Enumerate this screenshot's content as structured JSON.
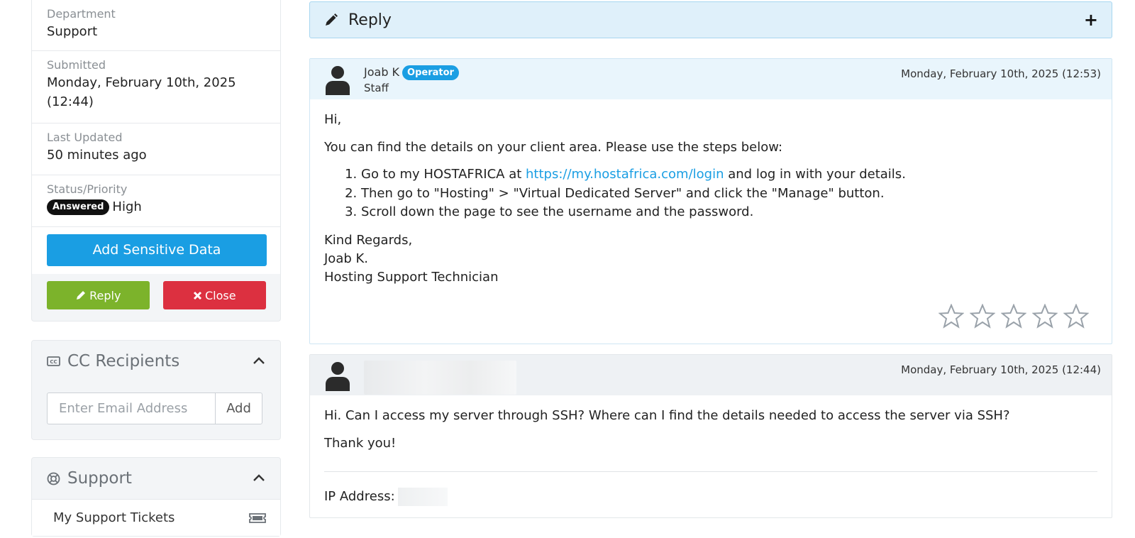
{
  "sidebar": {
    "department": {
      "label": "Department",
      "value": "Support"
    },
    "submitted": {
      "label": "Submitted",
      "value": "Monday, February 10th, 2025 (12:44)"
    },
    "last_updated": {
      "label": "Last Updated",
      "value": "50 minutes ago"
    },
    "status_priority": {
      "label": "Status/Priority",
      "status": "Answered",
      "priority": "High"
    },
    "add_sensitive_label": "Add Sensitive Data",
    "reply_label": "Reply",
    "close_label": "Close",
    "cc_panel": {
      "title": "CC Recipients",
      "placeholder": "Enter Email Address",
      "add_label": "Add"
    },
    "support_panel": {
      "title": "Support",
      "items": [
        {
          "label": "My Support Tickets",
          "icon": "ticket-icon"
        }
      ]
    }
  },
  "main": {
    "reply_bar": {
      "title": "Reply",
      "toggle": "+"
    },
    "messages": [
      {
        "author": "Joab K",
        "badge": "Operator",
        "role": "Staff",
        "date": "Monday, February 10th, 2025 (12:53)",
        "greeting": "Hi,",
        "intro": "You can find the details on your client area. Please use the steps below:",
        "step1_pre": "Go to my HOSTAFRICA at ",
        "step1_link": "https://my.hostafrica.com/login",
        "step1_post": " and log in with your details.",
        "step2": "Then go to \"Hosting\" > \"Virtual Dedicated Server\" and click the \"Manage\" button.",
        "step3": "Scroll down the page to see the username and the password.",
        "sign1": "Kind Regards,",
        "sign2": "Joab K.",
        "sign3": "Hosting Support Technician",
        "rating_max": 5,
        "rating_value": 0
      },
      {
        "date": "Monday, February 10th, 2025 (12:44)",
        "line1": "Hi. Can I access my server through SSH? Where can I find the details needed to access the server via SSH?",
        "line2": "Thank you!",
        "ip_label": "IP Address:"
      }
    ]
  }
}
